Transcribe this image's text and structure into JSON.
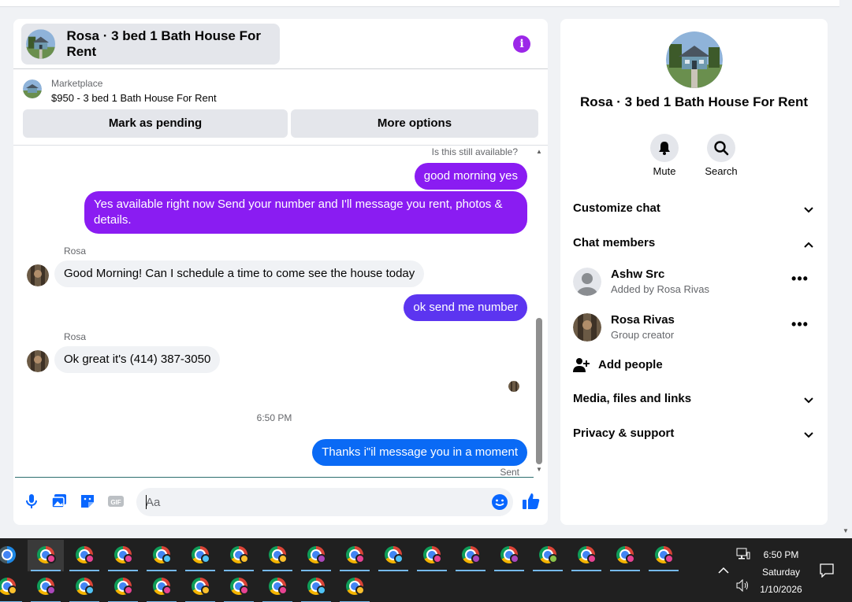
{
  "chat": {
    "title": "Rosa · 3 bed 1 Bath House For Rent",
    "info_icon": "i",
    "listing": {
      "source": "Marketplace",
      "description": "$950 - 3 bed 1 Bath House For Rent",
      "pending_label": "Mark as pending",
      "more_label": "More options"
    },
    "preview_text": "Is this still available?",
    "messages": {
      "m1": "good morning yes",
      "m2": "Yes available right now Send your number and I'll message you rent, photos & details.",
      "sender1": "Rosa",
      "m3": "Good Morning! Can I schedule a time to come see the house today",
      "m4": "ok send me number",
      "sender2": "Rosa",
      "m5": "Ok great it's (414) 387-3050",
      "time": "6:50 PM",
      "m6": "Thanks i\"il message you in a moment",
      "sent": "Sent"
    },
    "composer": {
      "placeholder": "Aa",
      "gif_label": "GIF"
    }
  },
  "info": {
    "title": "Rosa · 3 bed 1 Bath House For Rent",
    "mute_label": "Mute",
    "search_label": "Search",
    "customize_label": "Customize chat",
    "members_label": "Chat members",
    "members": [
      {
        "name": "Ashw Src",
        "sub": "Added by Rosa Rivas"
      },
      {
        "name": "Rosa Rivas",
        "sub": "Group creator"
      }
    ],
    "more_dots": "•••",
    "add_people_label": "Add people",
    "media_label": "Media, files and links",
    "privacy_label": "Privacy & support"
  },
  "taskbar": {
    "time": "6:50 PM",
    "day": "Saturday",
    "date": "1/10/2026",
    "profile_colors": [
      "#e84393",
      "#e84393",
      "#e84393",
      "#4fc3f7",
      "#4fc3f7",
      "#fbc02d",
      "#fbc02d",
      "#ab47bc",
      "#e84393",
      "#4fc3f7",
      "#e84393",
      "#ab47bc",
      "#ab47bc",
      "#8bc34a",
      "#e84393",
      "#e84393",
      "#e84393",
      "#fbc02d",
      "#ab47bc",
      "#4fc3f7",
      "#e84393",
      "#e84393",
      "#fbc02d",
      "#e84393",
      "#e84393",
      "#4fc3f7",
      "#fbc02d"
    ]
  },
  "colors": {
    "purple_bubble": "#8a1cf2",
    "indigo_bubble": "#5c35f0",
    "blue_bubble": "#0a6af5",
    "accent_icon": "#0866ff"
  }
}
